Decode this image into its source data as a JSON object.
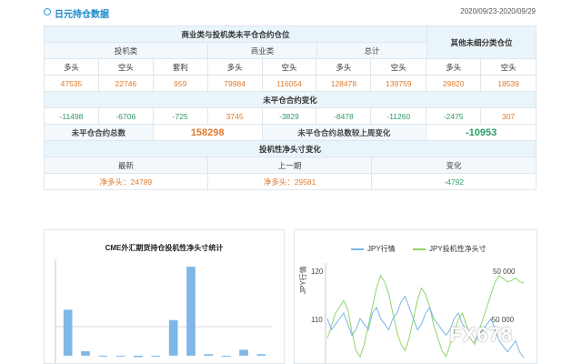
{
  "header": {
    "title": "日元持仓数据",
    "date_range": "2020/09/23-2020/09/29"
  },
  "table": {
    "group1_title": "商业类与投机类未平仓合约仓位",
    "group2_title": "其他未细分类仓位",
    "subgroups": [
      "投机类",
      "商业类",
      "总计"
    ],
    "columns": [
      "多头",
      "空头",
      "套利",
      "多头",
      "空头",
      "多头",
      "空头",
      "多头",
      "空头"
    ],
    "positions": [
      "47535",
      "22746",
      "959",
      "79984",
      "116054",
      "128478",
      "139759",
      "29820",
      "18539"
    ],
    "change_title": "未平仓合约变化",
    "changes": [
      "-11498",
      "-6706",
      "-725",
      "3745",
      "-3829",
      "-8478",
      "-11260",
      "-2475",
      "307"
    ],
    "total_label": "未平仓合约总数",
    "total_value": "158298",
    "total_change_label": "未平仓合约总数较上周变化",
    "total_change_value": "-10953",
    "net_title": "投机性净头寸变化",
    "net_headers": [
      "最新",
      "上一期",
      "变化"
    ],
    "net_latest": "净多头：24789",
    "net_previous": "净多头：29581",
    "net_change": "-4792"
  },
  "chart1": {
    "title": "CME外汇期货持仓投机性净头寸统计"
  },
  "chart2": {
    "legend_jpy": "JPY行情",
    "legend_net": "JPY投机性净头寸",
    "ylabel": "JPY行情",
    "left_ticks": [
      "120",
      "110"
    ],
    "right_ticks": [
      "50 000",
      "-50 000"
    ]
  },
  "watermark": "FX678",
  "colors": {
    "bar": "#7fb7e6",
    "jpy_line": "#7ab6e3",
    "net_line": "#8fd46a",
    "accent": "#1a88c9"
  },
  "chart_data": [
    {
      "type": "bar",
      "title": "CME外汇期货持仓投机性净头寸统计",
      "values": [
        0.62,
        0.06,
        0.0,
        0.0,
        -0.02,
        0.0,
        0.48,
        1.2,
        0.02,
        -0.01,
        0.08,
        0.02
      ],
      "ylim": [
        -0.1,
        1.3
      ]
    },
    {
      "type": "line",
      "series": [
        {
          "name": "JPY行情",
          "values": [
            112,
            110,
            111,
            112,
            113,
            111,
            109,
            110,
            112,
            111,
            110,
            113,
            114,
            112,
            111,
            110,
            112,
            113,
            115,
            116,
            114,
            112,
            110,
            111,
            113,
            114,
            112,
            111,
            110,
            109,
            110,
            112,
            113,
            111,
            110,
            109,
            108,
            109,
            110,
            111,
            112,
            110,
            108,
            107,
            106,
            107,
            108,
            106,
            105
          ]
        },
        {
          "name": "JPY投机性净头寸",
          "values": [
            -40000,
            -20000,
            0,
            10000,
            20000,
            5000,
            -30000,
            -60000,
            -70000,
            -50000,
            -20000,
            10000,
            40000,
            60000,
            50000,
            30000,
            0,
            -30000,
            -50000,
            -60000,
            -40000,
            -10000,
            20000,
            40000,
            30000,
            10000,
            -20000,
            -40000,
            -60000,
            -70000,
            -50000,
            -30000,
            -10000,
            0,
            -20000,
            -40000,
            -50000,
            -30000,
            -10000,
            10000,
            30000,
            50000,
            60000,
            55000,
            50000,
            52000,
            56000,
            50000,
            48000
          ]
        }
      ]
    }
  ]
}
